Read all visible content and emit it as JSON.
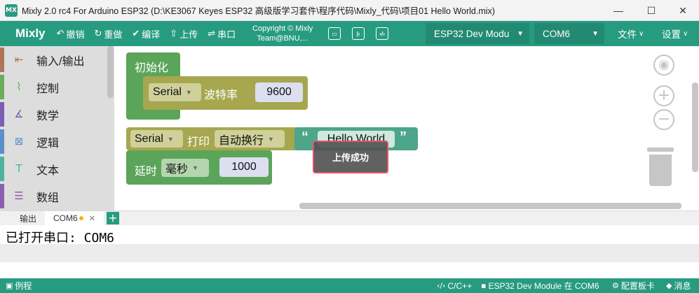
{
  "window": {
    "title": "Mixly 2.0 rc4 For Arduino ESP32 (D:\\KE3067 Keyes ESP32 高级版学习套件\\程序代码\\Mixly_代码\\项目01 Hello World.mix)",
    "icon_text": "MX",
    "minimize": "—",
    "maximize": "☐",
    "close": "✕"
  },
  "toolbar": {
    "brand": "Mixly",
    "undo": "撤销",
    "redo": "重做",
    "compile": "编译",
    "upload": "上传",
    "serial": "串口",
    "copyright_line1": "Copyright © Mixly",
    "copyright_line2": "Team@BNU,...",
    "board": "ESP32 Dev Modu",
    "port": "COM6",
    "file_menu": "文件",
    "settings_menu": "设置"
  },
  "sidebar": {
    "items": [
      {
        "label": "输入/输出",
        "color": "#b07457",
        "icon": "io-icon"
      },
      {
        "label": "控制",
        "color": "#6aad5e",
        "icon": "control-icon"
      },
      {
        "label": "数学",
        "color": "#7a5fb3",
        "icon": "math-icon"
      },
      {
        "label": "逻辑",
        "color": "#5b8fc9",
        "icon": "logic-icon"
      },
      {
        "label": "文本",
        "color": "#4db39a",
        "icon": "text-icon"
      },
      {
        "label": "数组",
        "color": "#8a5fb0",
        "icon": "array-icon"
      }
    ]
  },
  "blocks": {
    "setup_label": "初始化",
    "serial": "Serial",
    "baud_label": "波特率",
    "baud_value": "9600",
    "print_label": "打印",
    "newline_option": "自动换行",
    "string_value": "Hello World",
    "quote_open": "“",
    "quote_close": "”",
    "delay_label": "延时",
    "delay_unit": "毫秒",
    "delay_value": "1000"
  },
  "toast": {
    "message": "上传成功"
  },
  "output": {
    "tabs": [
      {
        "label": "输出"
      },
      {
        "label": "COM6"
      }
    ],
    "add_tab": "+",
    "console_text": "已打开串口: COM6"
  },
  "statusbar": {
    "examples": "例程",
    "language": "C/C++",
    "board_status": "ESP32 Dev Module 在 COM6",
    "board_config": "配置板卡",
    "messages": "消息"
  }
}
